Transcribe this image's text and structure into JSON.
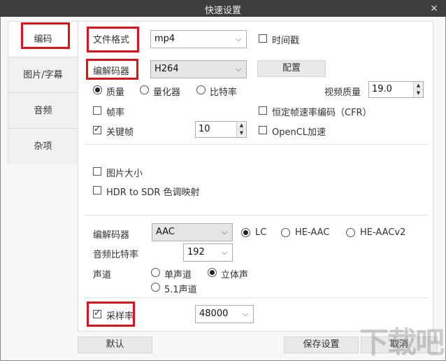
{
  "window": {
    "title": "快速设置",
    "close_glyph": "×"
  },
  "sidebar": {
    "items": [
      {
        "label": "编码"
      },
      {
        "label": "图片/字幕"
      },
      {
        "label": "音频"
      },
      {
        "label": "杂项"
      }
    ]
  },
  "video": {
    "format_label": "文件格式",
    "format_value": "mp4",
    "timestamp_label": "时间戳",
    "encoder_label": "编解码器",
    "encoder_value": "H264",
    "config_button": "配置",
    "mode_quality": "质量",
    "mode_quantizer": "量化器",
    "mode_bitrate": "比特率",
    "quality_label": "视频质量",
    "quality_value": "19.0",
    "framerate_label": "帧率",
    "cfr_label": "恒定帧速率编码（CFR）",
    "keyframe_label": "关键帧",
    "keyframe_value": "10",
    "opencl_label": "OpenCL加速"
  },
  "picture": {
    "size_label": "图片大小",
    "hdr_label": "HDR to SDR 色调映射"
  },
  "audio": {
    "encoder_label": "编解码器",
    "encoder_value": "AAC",
    "profile_lc": "LC",
    "profile_he": "HE-AAC",
    "profile_hev2": "HE-AACv2",
    "bitrate_label": "音频比特率",
    "bitrate_value": "192",
    "channel_label": "声道",
    "channel_mono": "单声道",
    "channel_stereo": "立体声",
    "channel_51": "5.1声道",
    "samplerate_label": "采样率",
    "samplerate_value": "48000"
  },
  "footer": {
    "default_button": "默认",
    "save_button": "保存设置",
    "cancel_button": "取消"
  },
  "watermark": {
    "text": "下载吧"
  }
}
